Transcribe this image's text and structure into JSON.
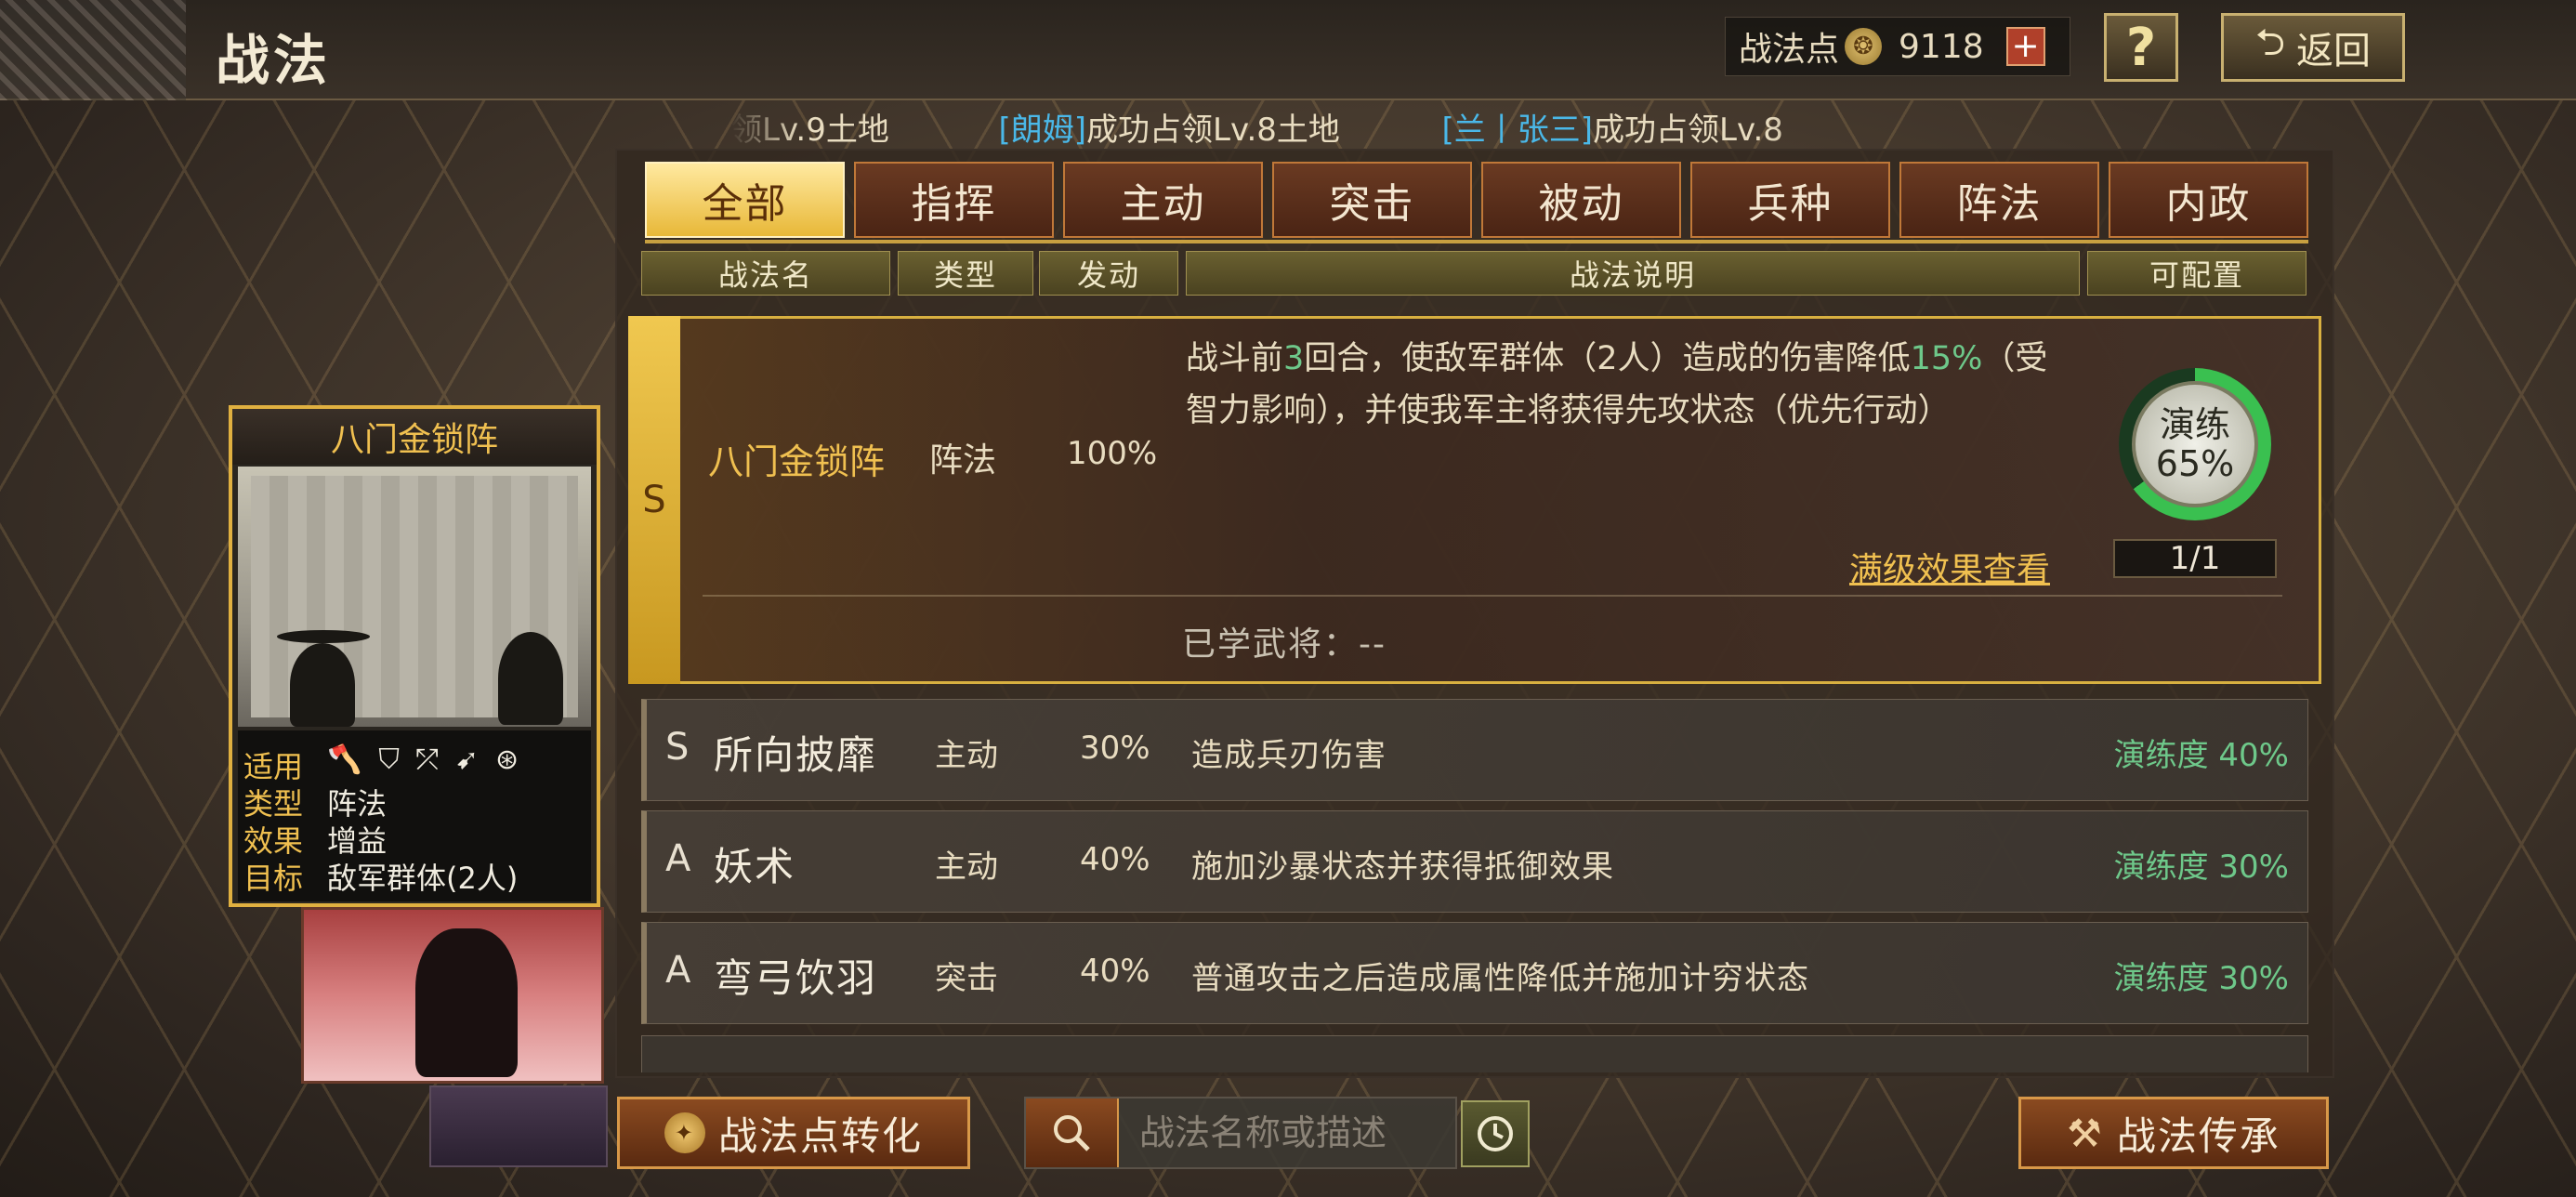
{
  "header": {
    "title": "战法",
    "points_label": "战法点",
    "points_value": "9118",
    "plus_label": "+",
    "help_label": "?",
    "back_label": "返回"
  },
  "ticker": {
    "segments": [
      {
        "pre": "领Lv.9土地",
        "name": "",
        "post": ""
      },
      {
        "pre": "",
        "name": "[朗姆]",
        "post": "成功占领Lv.8土地"
      },
      {
        "pre": "",
        "name": "[兰丨张三]",
        "post": "成功占领Lv.8"
      }
    ]
  },
  "tabs": [
    "全部",
    "指挥",
    "主动",
    "突击",
    "被动",
    "兵种",
    "阵法",
    "内政"
  ],
  "active_tab": 0,
  "columns": [
    "战法名",
    "类型",
    "发动",
    "战法说明",
    "可配置"
  ],
  "selected": {
    "grade": "S",
    "name": "八门金锁阵",
    "type": "阵法",
    "rate": "100%",
    "desc_1": "战斗前",
    "desc_2": "3",
    "desc_3": "回合，使敌军群体（2人）造成的伤害降低",
    "desc_4": "15%",
    "desc_5": "（受智力影响），并使我军主将获得先攻状态（优先行动）",
    "practice_label": "演练",
    "practice_value": "65%",
    "practice_fraction": 0.65,
    "max_effect_link": "满级效果查看",
    "count": "1/1",
    "learned": "已学武将：--"
  },
  "rows": [
    {
      "grade": "S",
      "name": "所向披靡",
      "type": "主动",
      "rate": "30%",
      "desc": "造成兵刃伤害",
      "prof": "演练度 40%"
    },
    {
      "grade": "A",
      "name": "妖术",
      "type": "主动",
      "rate": "40%",
      "desc": "施加沙暴状态并获得抵御效果",
      "prof": "演练度 30%"
    },
    {
      "grade": "A",
      "name": "弯弓饮羽",
      "type": "突击",
      "rate": "40%",
      "desc": "普通攻击之后造成属性降低并施加计穷状态",
      "prof": "演练度 30%"
    }
  ],
  "card": {
    "title": "八门金锁阵",
    "labels": [
      "适用",
      "类型",
      "效果",
      "目标"
    ],
    "type": "阵法",
    "effect": "增益",
    "target": "敌军群体(2人)",
    "unit_icons": [
      "axe-icon",
      "shield-icon",
      "bow-icon",
      "spear-icon",
      "wheel-icon"
    ]
  },
  "bottom": {
    "convert_label": "战法点转化",
    "search_placeholder": "战法名称或描述",
    "inherit_label": "战法传承"
  }
}
